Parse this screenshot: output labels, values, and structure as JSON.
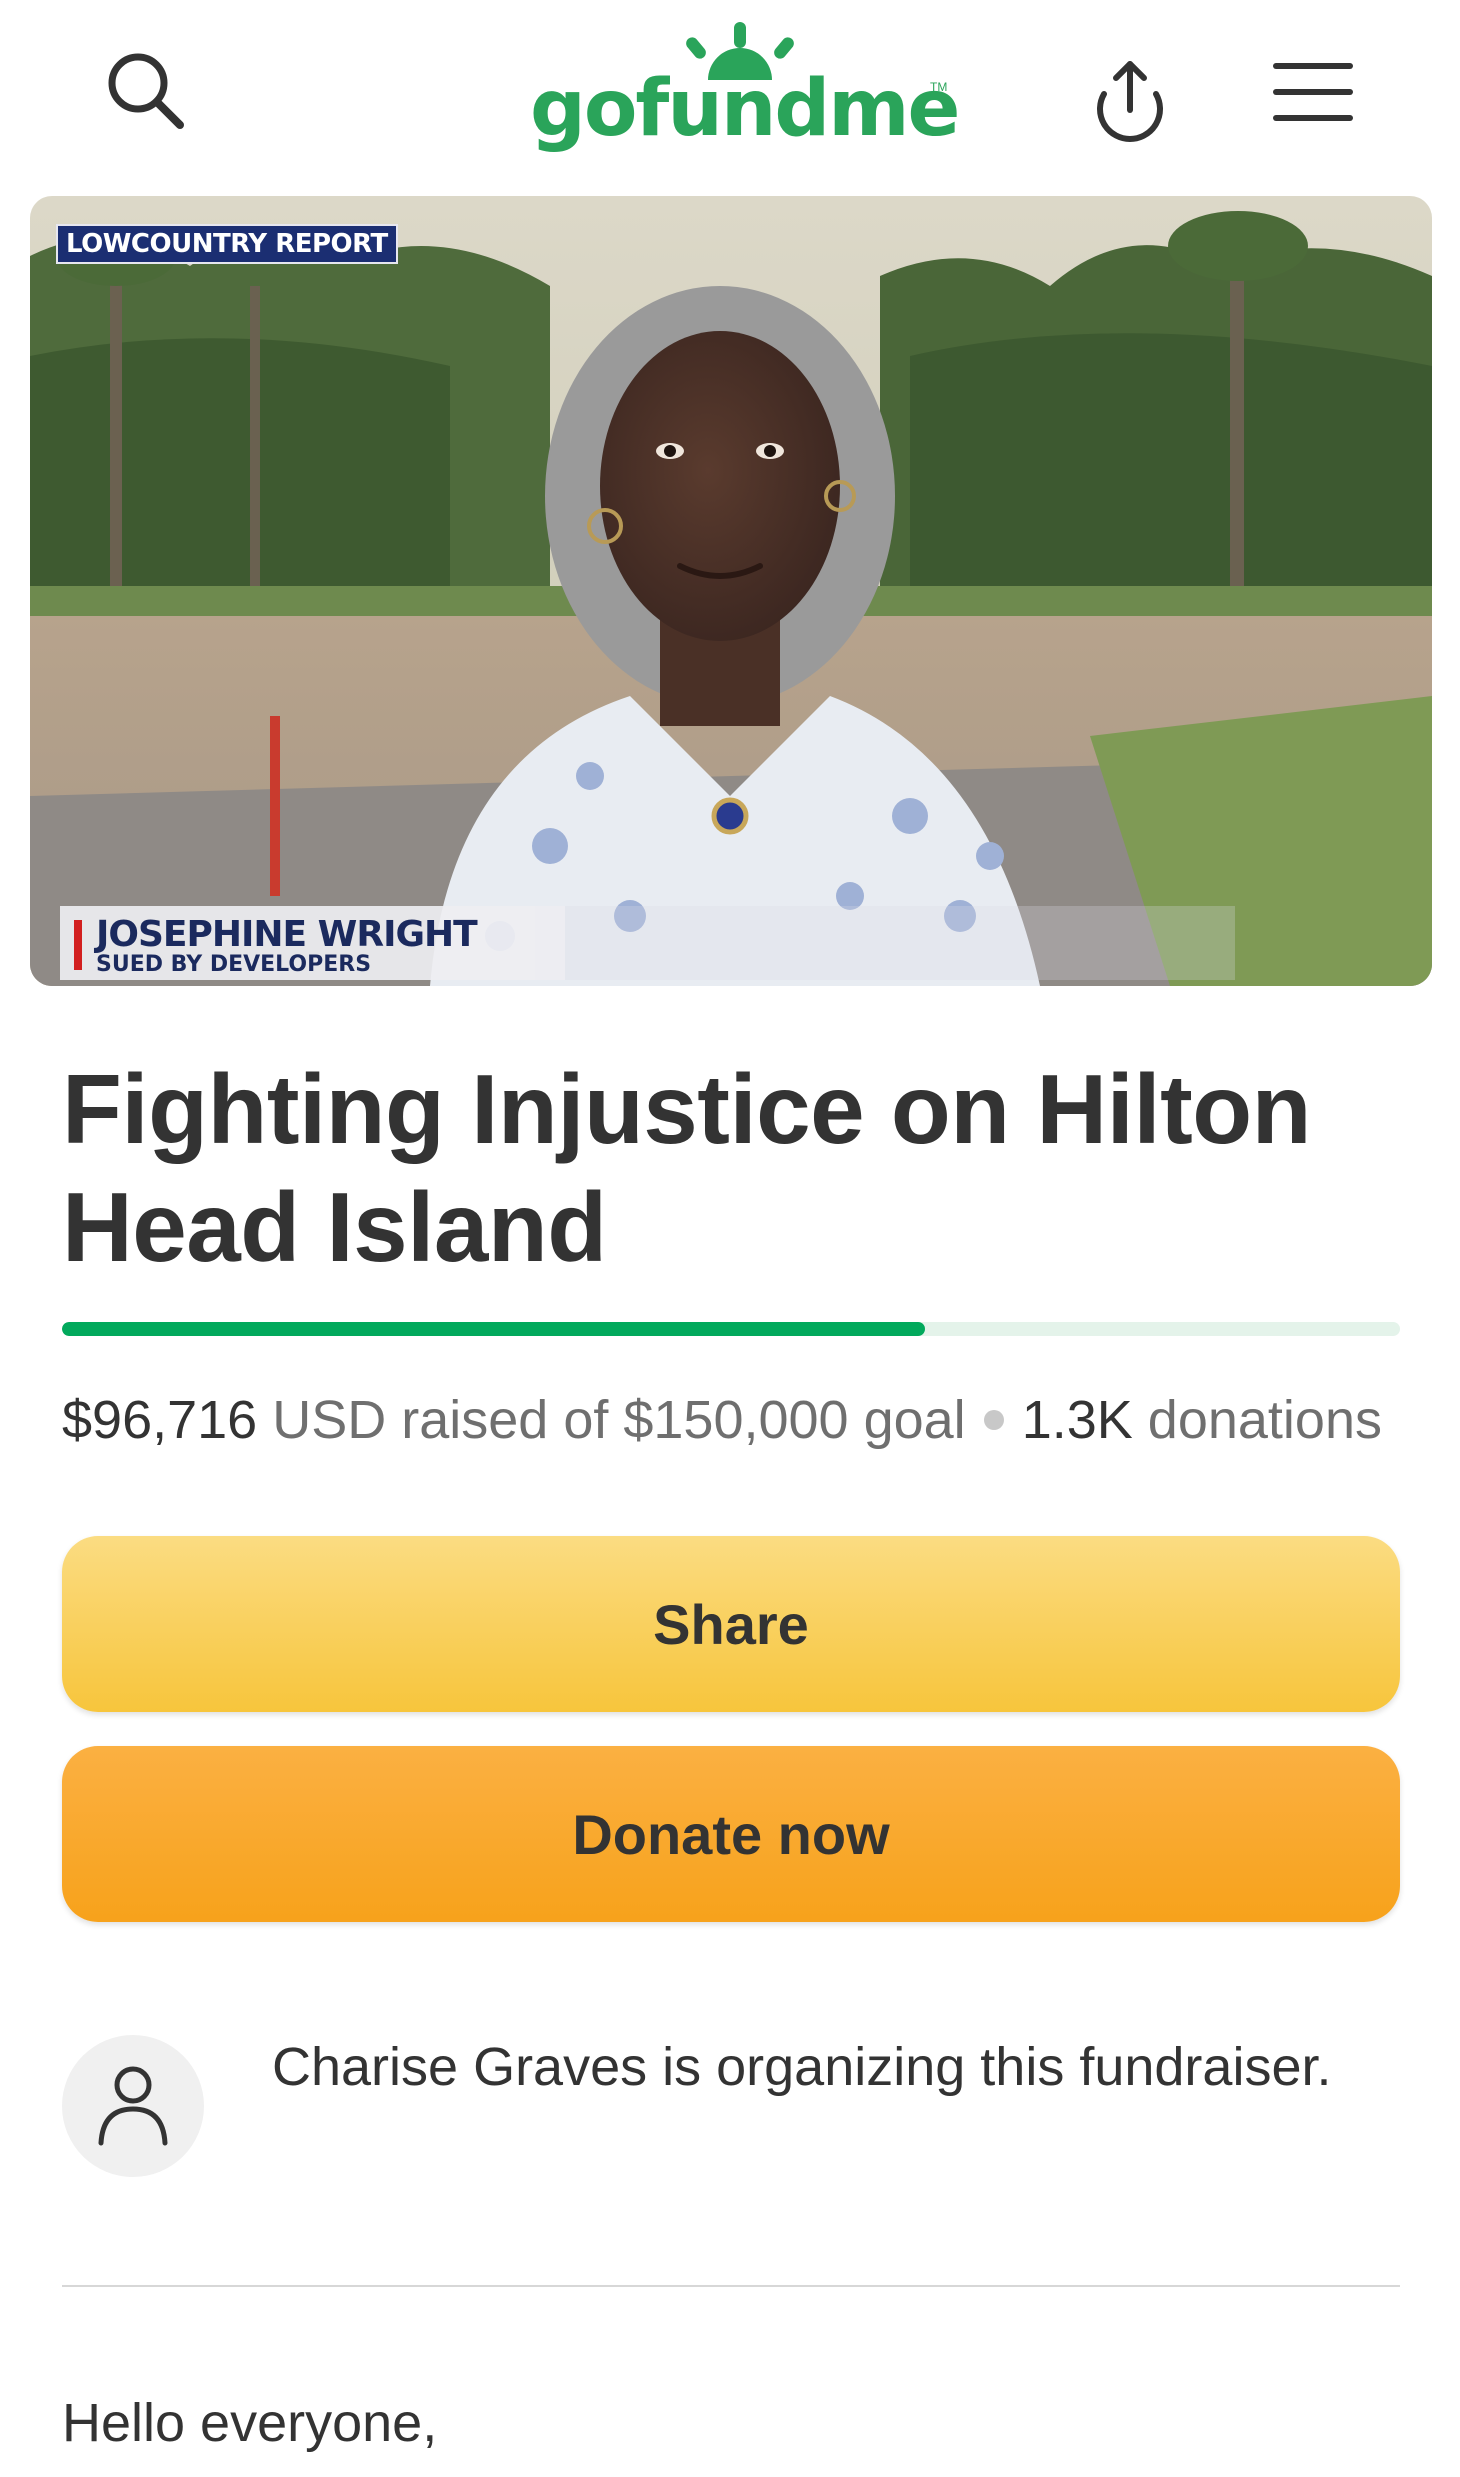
{
  "header": {
    "logo_text": "gofundme",
    "logo_tm": "TM"
  },
  "hero": {
    "bug_text": "LOWCOUNTRY REPORT",
    "lower_third_name": "JOSEPHINE WRIGHT",
    "lower_third_subtitle": "SUED BY DEVELOPERS"
  },
  "campaign": {
    "title": "Fighting Injustice on Hilton Head Island",
    "progress_fraction": 0.645,
    "raised_amount": "$96,716",
    "raised_text": "USD raised of $150,000 goal",
    "donations_count": "1.3K",
    "donations_label": "donations"
  },
  "buttons": {
    "share_label": "Share",
    "donate_label": "Donate now"
  },
  "organizer": {
    "text": "Charise Graves is organizing this fundraiser."
  },
  "story": {
    "greeting": "Hello everyone,"
  },
  "colors": {
    "brand_green": "#02a95c",
    "share_yellow": "#f7c53c",
    "donate_orange": "#f7a21b",
    "progress_track": "#e4f3ea"
  }
}
